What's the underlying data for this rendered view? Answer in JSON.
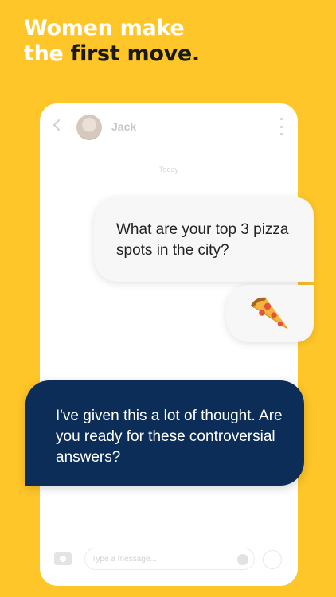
{
  "headline": {
    "line1": "Women make",
    "line2_prefix": "the ",
    "line2_emphasis": "first move."
  },
  "chat": {
    "contact_name": "Jack",
    "day_label": "Today",
    "messages": [
      {
        "text": "What are your top 3 pizza spots in the city?"
      },
      {
        "emoji": "pizza"
      },
      {
        "text": "I've given this a lot of thought. Are you ready for these controversial answers?"
      }
    ],
    "input_placeholder": "Type a message..."
  },
  "colors": {
    "background": "#FFC629",
    "reply_bubble": "#0C2D57",
    "headline_white": "#FFFFFF",
    "headline_dark": "#1A1A1A"
  },
  "icons": [
    "back-arrow-icon",
    "kebab-menu-icon",
    "camera-icon",
    "emoji-icon",
    "send-icon",
    "pizza-icon"
  ]
}
